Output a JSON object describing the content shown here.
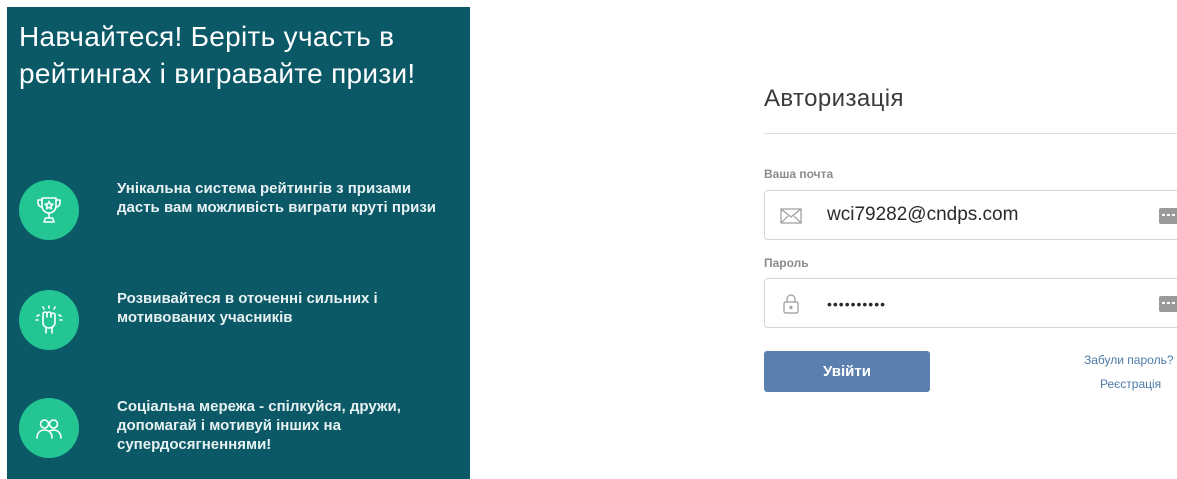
{
  "promo": {
    "title": "Навчайтеся! Беріть участь в рейтингах і вигравайте призи!",
    "features": [
      {
        "icon": "trophy-icon",
        "text": "Унікальна система рейтингів з призами дасть вам можливість виграти круті призи"
      },
      {
        "icon": "raised-fist-icon",
        "text": "Розвивайтеся в оточенні сильних і мотивованих учасників"
      },
      {
        "icon": "people-icon",
        "text": "Соціальна мережа - спілкуйся, дружи, допомагай і мотивуй інших на супердосягненнями!"
      }
    ],
    "colors": {
      "background": "#0b5967",
      "badge": "#23c692"
    }
  },
  "auth": {
    "title": "Авторизація",
    "email_label": "Ваша почта",
    "email_value": "wci79282@cndps.com",
    "password_label": "Пароль",
    "password_value": "••••••••••",
    "login_button": "Увійти",
    "forgot_link": "Забули пароль?",
    "register_link": "Реєстрація",
    "colors": {
      "button": "#5b7fae",
      "link": "#4b79a6"
    }
  }
}
